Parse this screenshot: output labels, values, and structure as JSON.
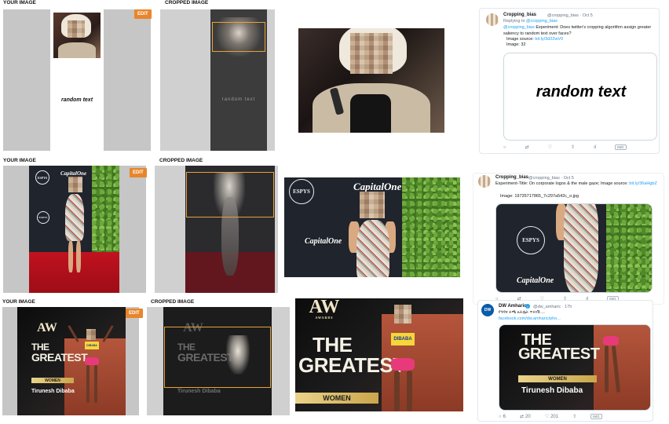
{
  "row1": {
    "left": {
      "label": "YOUR IMAGE",
      "edit": "EDIT",
      "caption": "random text"
    },
    "middle": {
      "label": "CROPPED IMAGE",
      "caption": "random text"
    },
    "tweet": {
      "name": "Cropping_bias",
      "handle": "@cropping_bias · Oct 5",
      "reply_prefix": "Replying to ",
      "reply_handle": "@cropping_bias",
      "mention": "@cropping_bias",
      "body": " Experiment: Does twitter's cropping algorithm assign greater saliency to random text over faces?",
      "source_label": "Image source: ",
      "source_link": "bit.ly/3d22wV0",
      "image_label": "Image: 32",
      "card_text": "random text",
      "stat": "IMG"
    }
  },
  "row2": {
    "left": {
      "label": "YOUR IMAGE",
      "edit": "EDIT"
    },
    "middle": {
      "label": "CROPPED IMAGE"
    },
    "espys": "ESPYS",
    "capone": "CapitalOne",
    "tweet": {
      "name": "Cropping_bias",
      "handle": "@cropping_bias · Oct 5",
      "body": "Experiment-Title: On corporate logos & the male gaze; Image source: ",
      "source_link": "bit.ly/36aHgbZ",
      "image_label": "Image: 19735717865_7c297a542c_o.jpg",
      "stat": "IMG"
    }
  },
  "row3": {
    "left": {
      "label": "YOUR IMAGE",
      "edit": "EDIT"
    },
    "middle": {
      "label": "CROPPED IMAGE"
    },
    "aw": "AW",
    "awards": "AWARDS",
    "the": "THE",
    "greatest": "GREATEST",
    "women": "WOMEN",
    "runner": "Tirunesh Dibaba",
    "bib": "DIBABA",
    "tweet": {
      "name": "DW Amharic",
      "handle": "@dw_amharic · 17h",
      "body": "የጎዳና ሩጫ አትሌት ጥሩነሽ ...",
      "link": "facebook.com/dw.amharic/pho...",
      "replies": "6",
      "retweets": "20",
      "likes": "201",
      "stat": "IMG"
    }
  },
  "colors": {
    "edit": "#e8862b",
    "crop_box": "#e8a23a",
    "twitter_blue": "#1da1f2",
    "red_carpet": "#c1121f",
    "women_bar": "#e9d28a",
    "shorts": "#e83a7a"
  },
  "icons": [
    "reply-icon",
    "retweet-icon",
    "like-icon",
    "share-icon",
    "analytics-icon",
    "verified-icon",
    "dw-logo"
  ]
}
